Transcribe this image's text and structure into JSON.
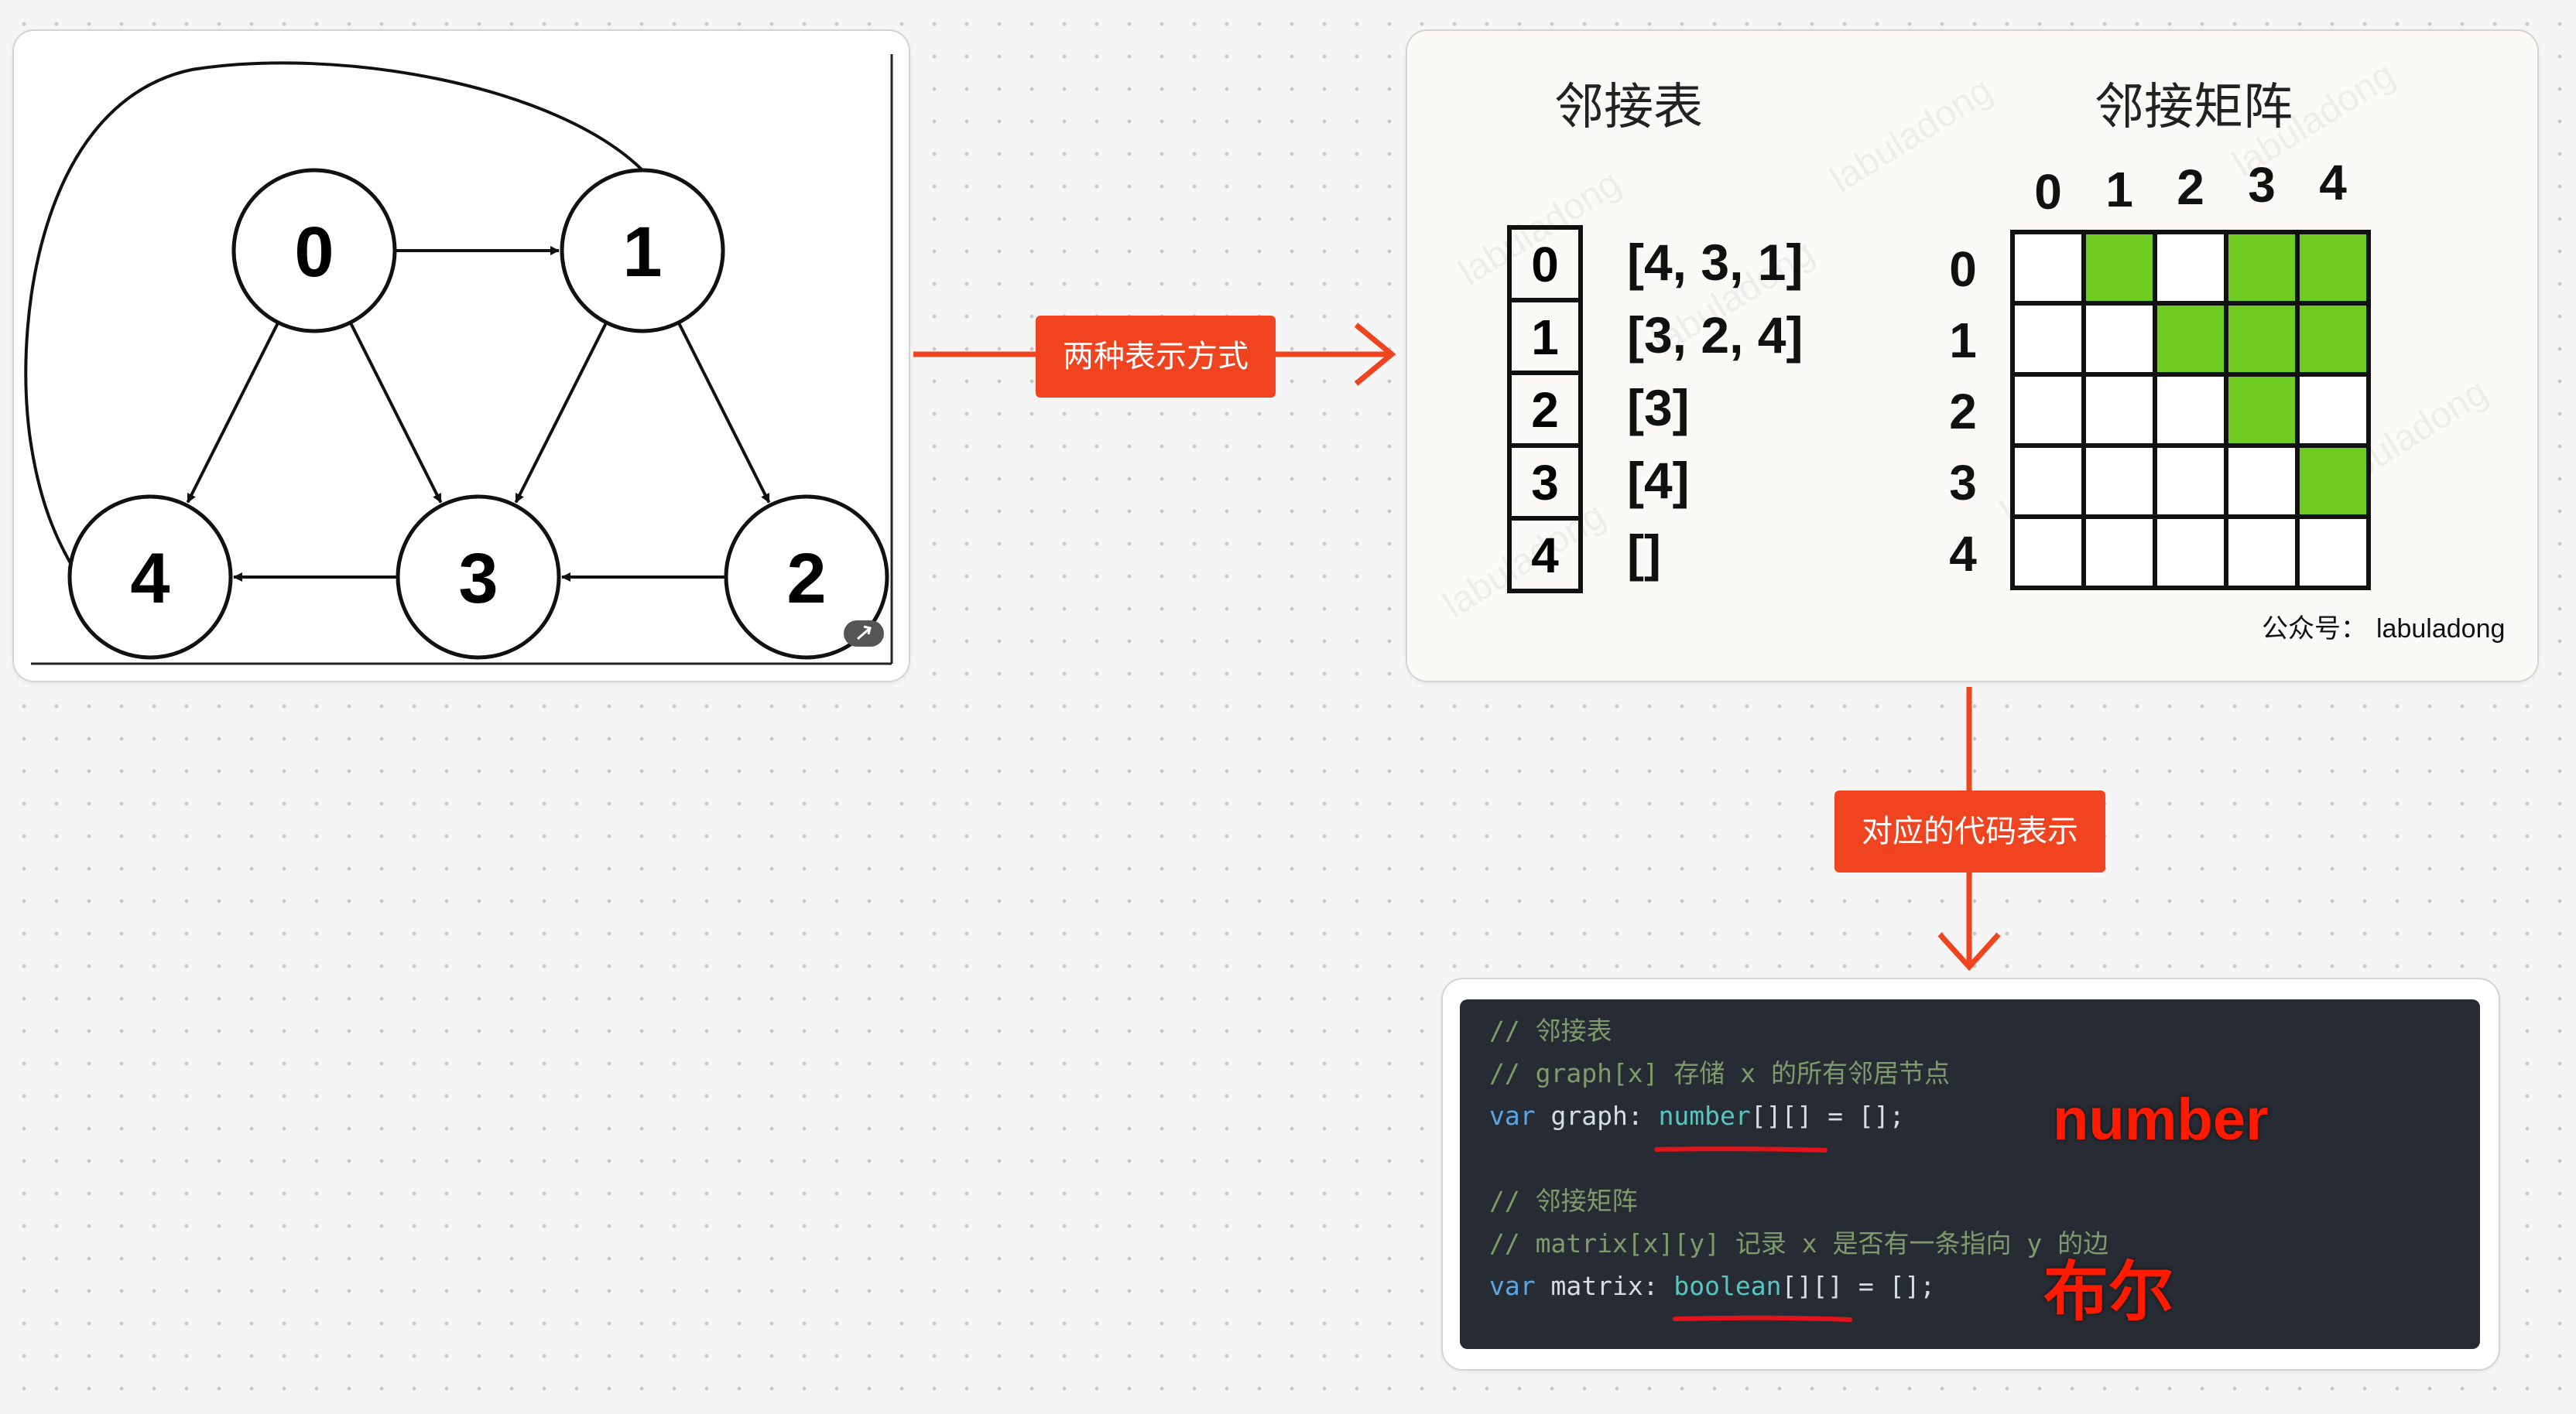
{
  "graph": {
    "nodes": [
      {
        "id": "0"
      },
      {
        "id": "1"
      },
      {
        "id": "2"
      },
      {
        "id": "3"
      },
      {
        "id": "4"
      }
    ],
    "edges": [
      [
        "0",
        "1"
      ],
      [
        "0",
        "4"
      ],
      [
        "0",
        "3"
      ],
      [
        "1",
        "3"
      ],
      [
        "1",
        "2"
      ],
      [
        "1",
        "4"
      ],
      [
        "2",
        "3"
      ],
      [
        "3",
        "4"
      ]
    ]
  },
  "labels": {
    "two_representations": "两种表示方式",
    "corresponding_code": "对应的代码表示"
  },
  "representations": {
    "adjacency_list_title": "邻接表",
    "adjacency_matrix_title": "邻接矩阵",
    "list_indices": [
      "0",
      "1",
      "2",
      "3",
      "4"
    ],
    "list_values": [
      "[4, 3, 1]",
      "[3, 2, 4]",
      "[3]",
      "[4]",
      "[]"
    ],
    "matrix_headers": [
      "0",
      "1",
      "2",
      "3",
      "4"
    ],
    "matrix": [
      [
        0,
        1,
        0,
        1,
        1
      ],
      [
        0,
        0,
        1,
        1,
        1
      ],
      [
        0,
        0,
        0,
        1,
        0
      ],
      [
        0,
        0,
        0,
        0,
        1
      ],
      [
        0,
        0,
        0,
        0,
        0
      ]
    ],
    "matrix_fill_color": "#6fcb1f",
    "watermark": "labuladong",
    "credit_prefix": "公众号：",
    "credit_name": "labuladong"
  },
  "code": {
    "line1": "// 邻接表",
    "line2": "// graph[x] 存储 x 的所有邻居节点",
    "line3_kw": "var",
    "line3_a": " graph: ",
    "line3_type": "number",
    "line3_b": "[][] = [];",
    "line5": "// 邻接矩阵",
    "line6": "// matrix[x][y] 记录 x 是否有一条指向 y 的边",
    "line7_kw": "var",
    "line7_a": " matrix: ",
    "line7_type": "boolean",
    "line7_b": "[][] = [];"
  },
  "annotations": {
    "number": "number",
    "boolean": "布尔"
  },
  "colors": {
    "accent": "#f0431f",
    "annotation": "#ff1a00"
  }
}
